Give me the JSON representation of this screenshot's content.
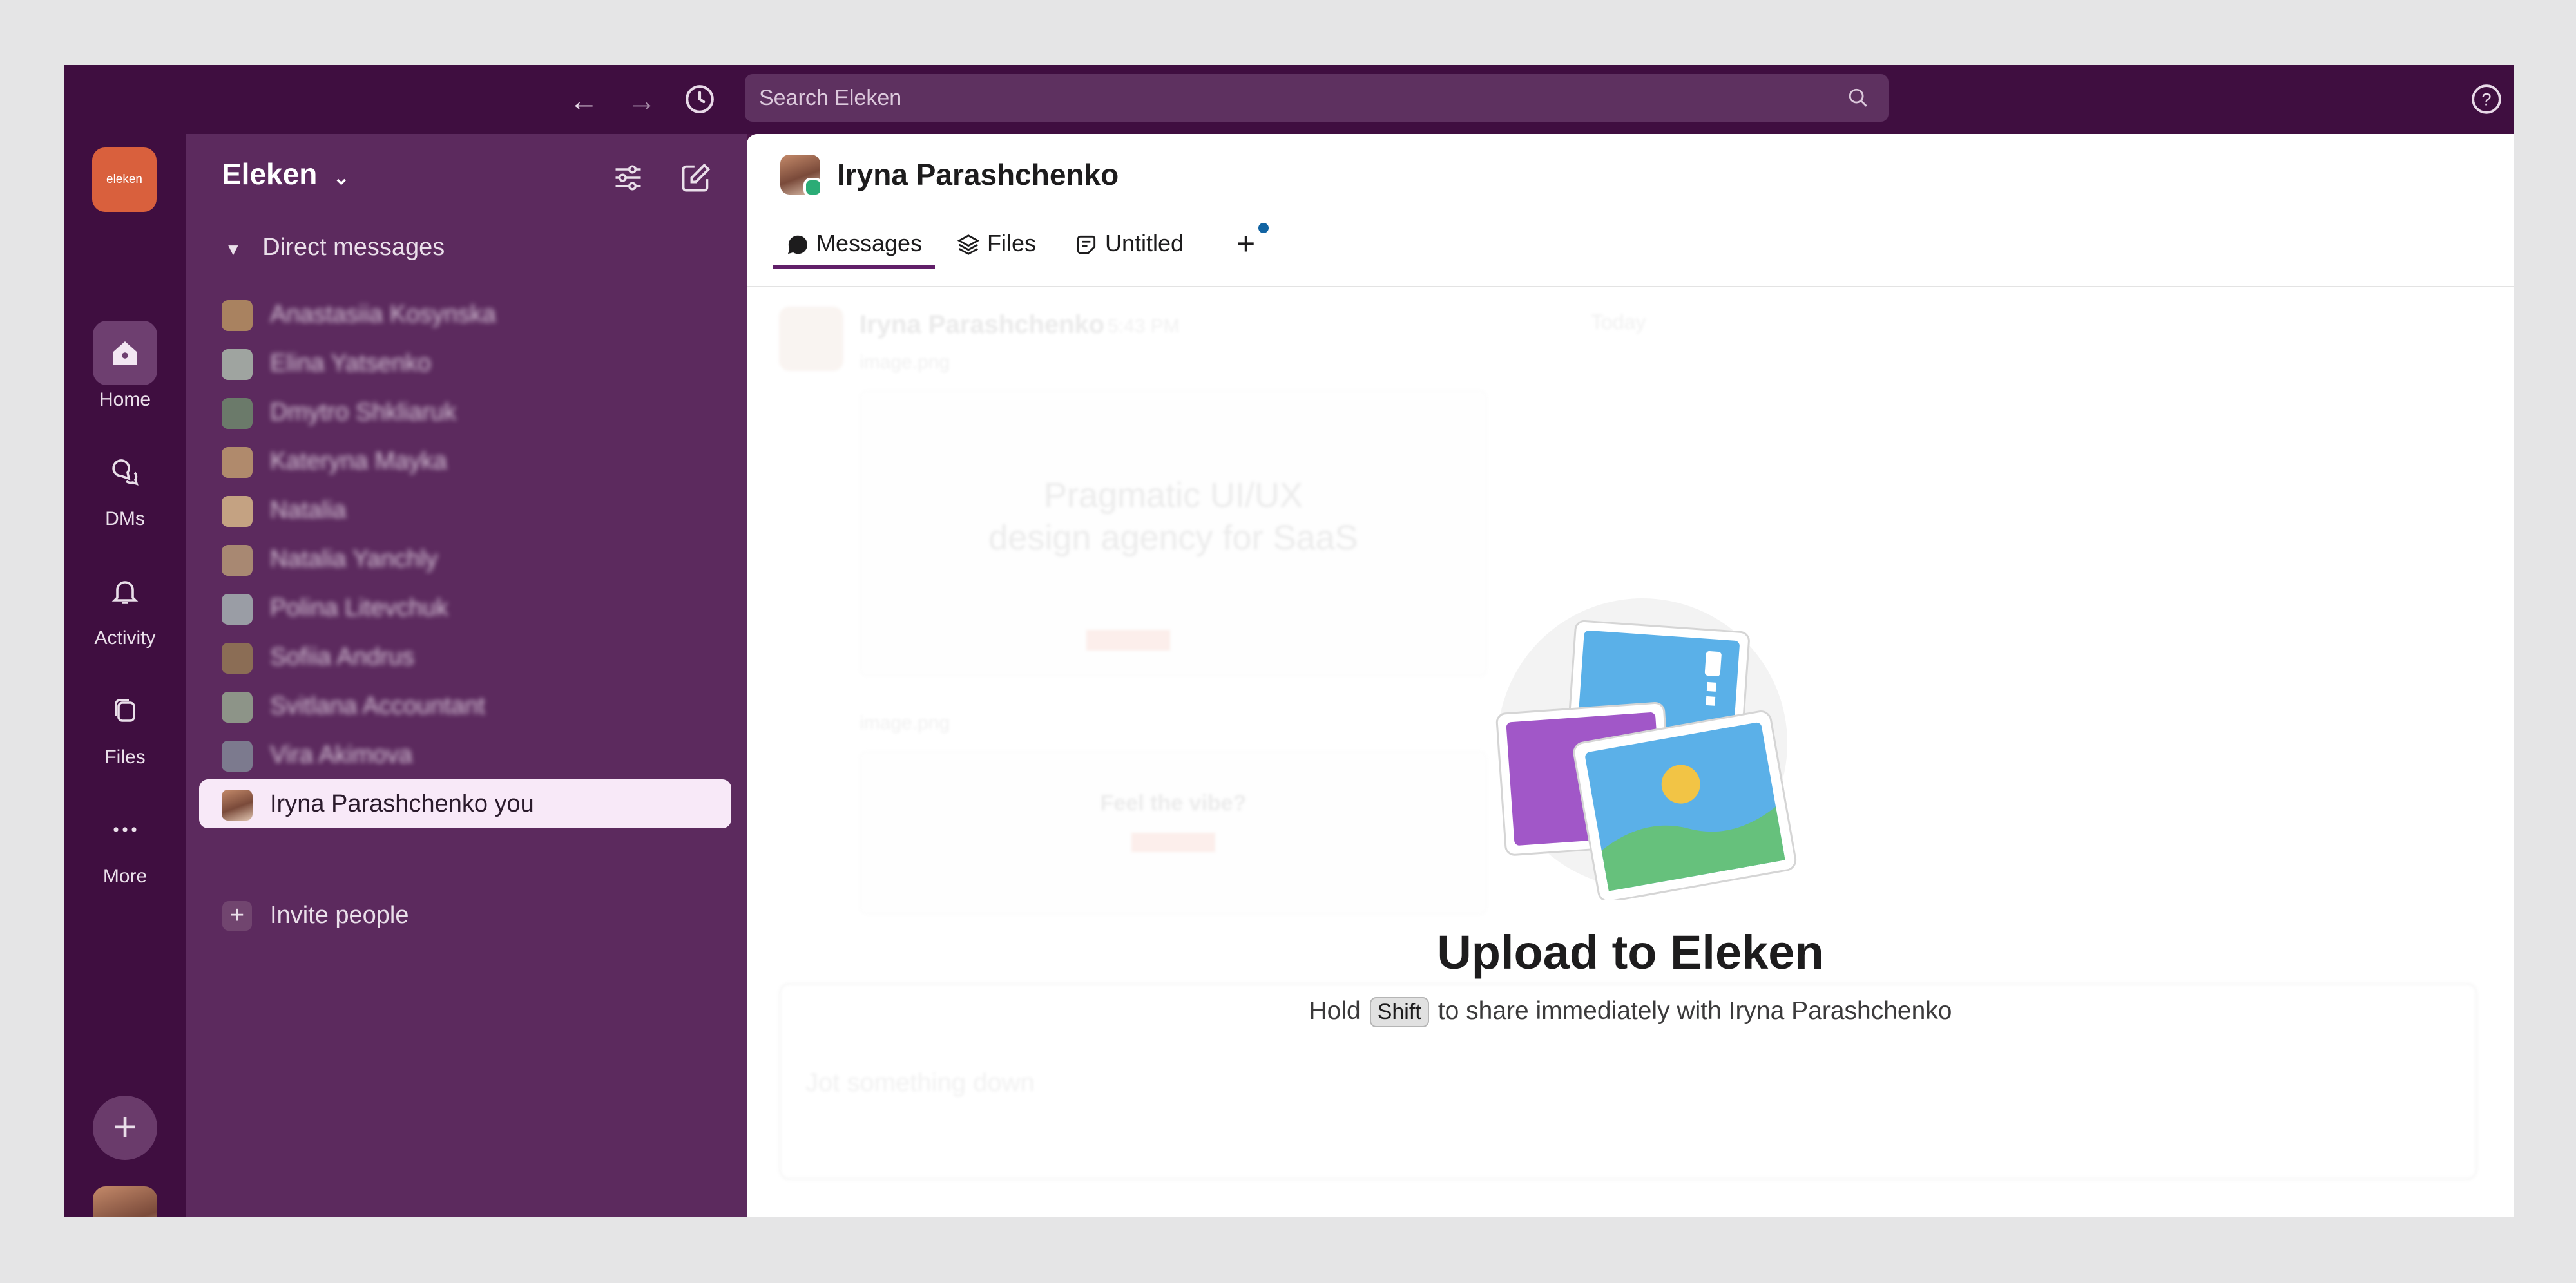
{
  "search": {
    "placeholder": "Search Eleken"
  },
  "workspace": {
    "logo_text": "eleken",
    "name": "Eleken"
  },
  "rail": {
    "items": [
      {
        "label": "Home",
        "icon": "home-icon"
      },
      {
        "label": "DMs",
        "icon": "dms-icon"
      },
      {
        "label": "Activity",
        "icon": "bell-icon"
      },
      {
        "label": "Files",
        "icon": "files-icon"
      },
      {
        "label": "More",
        "icon": "more-icon"
      }
    ]
  },
  "sidebar": {
    "section": "Direct messages",
    "dms": [
      {
        "name": "Anastasiia Kosynska"
      },
      {
        "name": "Elina Yatsenko"
      },
      {
        "name": "Dmytro Shkliaruk"
      },
      {
        "name": "Kateryna Mayka"
      },
      {
        "name": "Natalia"
      },
      {
        "name": "Natalia Yanchly"
      },
      {
        "name": "Polina Litevchuk"
      },
      {
        "name": "Sofiia Andrus"
      },
      {
        "name": "Svitlana Accountant"
      },
      {
        "name": "Vira Akimova"
      }
    ],
    "selected": "Iryna Parashchenko  you",
    "invite": "Invite people"
  },
  "channel": {
    "title": "Iryna Parashchenko",
    "tabs": [
      {
        "label": "Messages"
      },
      {
        "label": "Files"
      },
      {
        "label": "Untitled"
      }
    ]
  },
  "background_preview": {
    "sender": "Iryna Parashchenko",
    "time": "5:43 PM",
    "day": "Today",
    "file1": "image.png",
    "file2": "image.png",
    "headline1": "Pragmatic UI/UX",
    "headline2": "design agency for SaaS",
    "card2": "Feel the vibe?",
    "composer_placeholder": "Jot something down"
  },
  "upload": {
    "title": "Upload to Eleken",
    "hold": "Hold",
    "key": "Shift",
    "rest": "to share immediately with Iryna Parashchenko"
  },
  "colors": {
    "aubergine": "#3f0e40",
    "sidebar": "#5c2a5e",
    "accent": "#611f69",
    "online": "#2bac76",
    "selected_bg": "#f8e9f8"
  }
}
